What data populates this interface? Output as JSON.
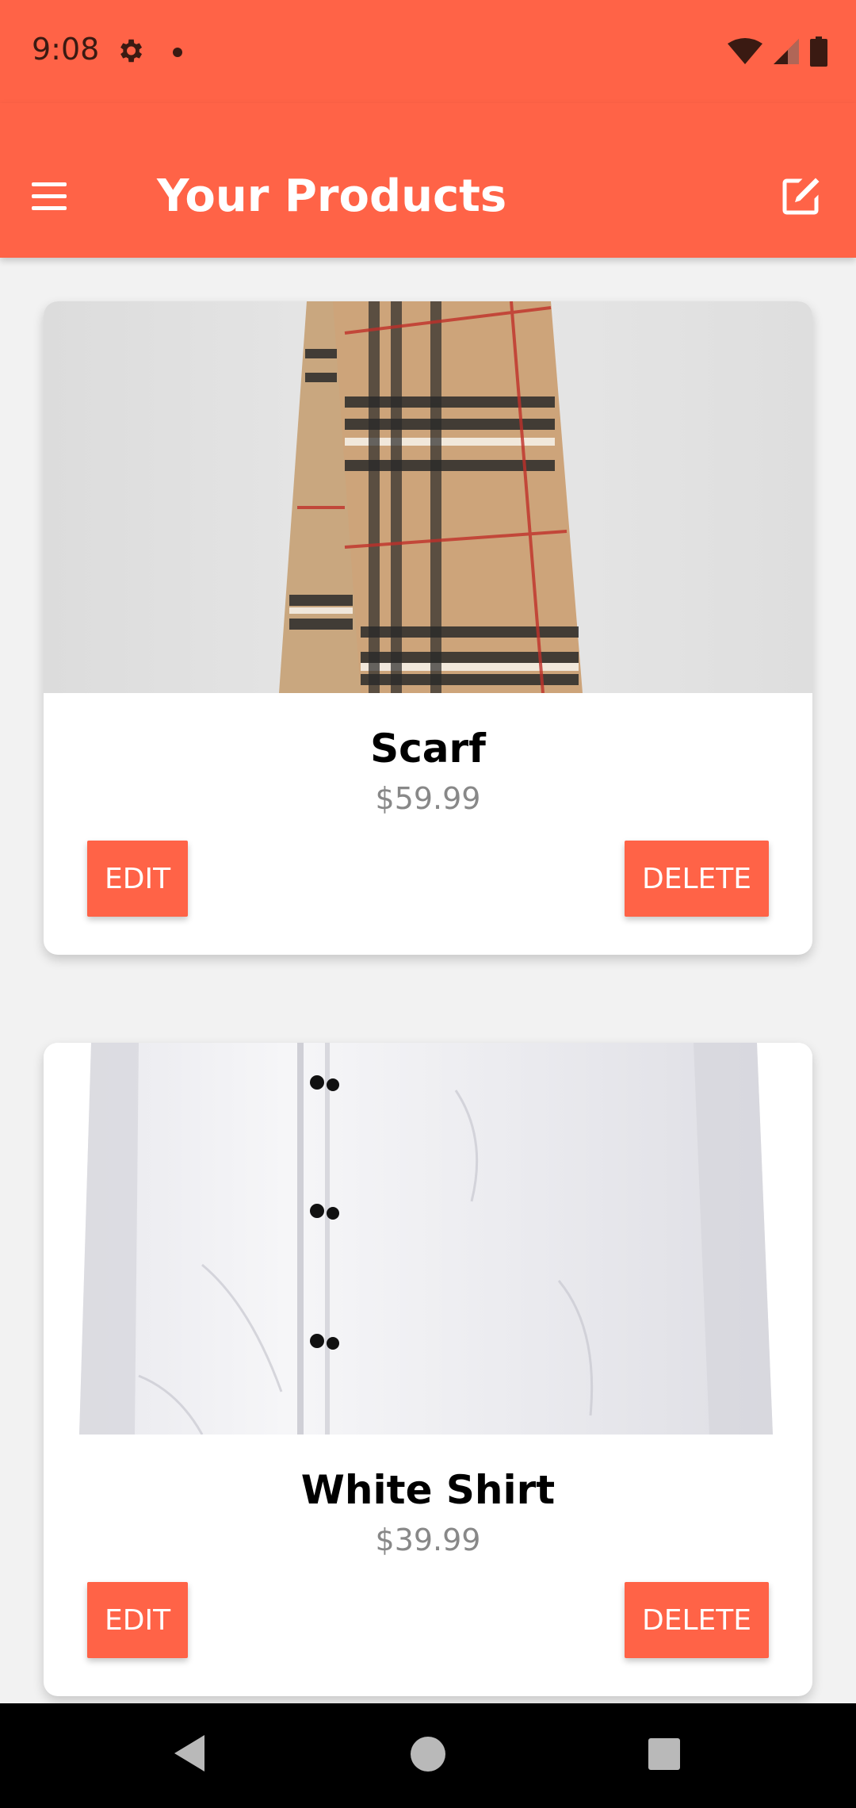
{
  "status_bar": {
    "time": "9:08"
  },
  "app_bar": {
    "title": "Your Products",
    "menu_icon": "menu-icon",
    "edit_icon": "edit-icon",
    "color": "#ff6347"
  },
  "products": [
    {
      "title": "Scarf",
      "price": "$59.99",
      "edit_label": "EDIT",
      "delete_label": "DELETE",
      "image": "scarf-image"
    },
    {
      "title": "White Shirt",
      "price": "$39.99",
      "edit_label": "EDIT",
      "delete_label": "DELETE",
      "image": "white-shirt-image"
    }
  ],
  "colors": {
    "accent": "#ff6347",
    "price": "#888888",
    "background": "#f2f2f2"
  }
}
